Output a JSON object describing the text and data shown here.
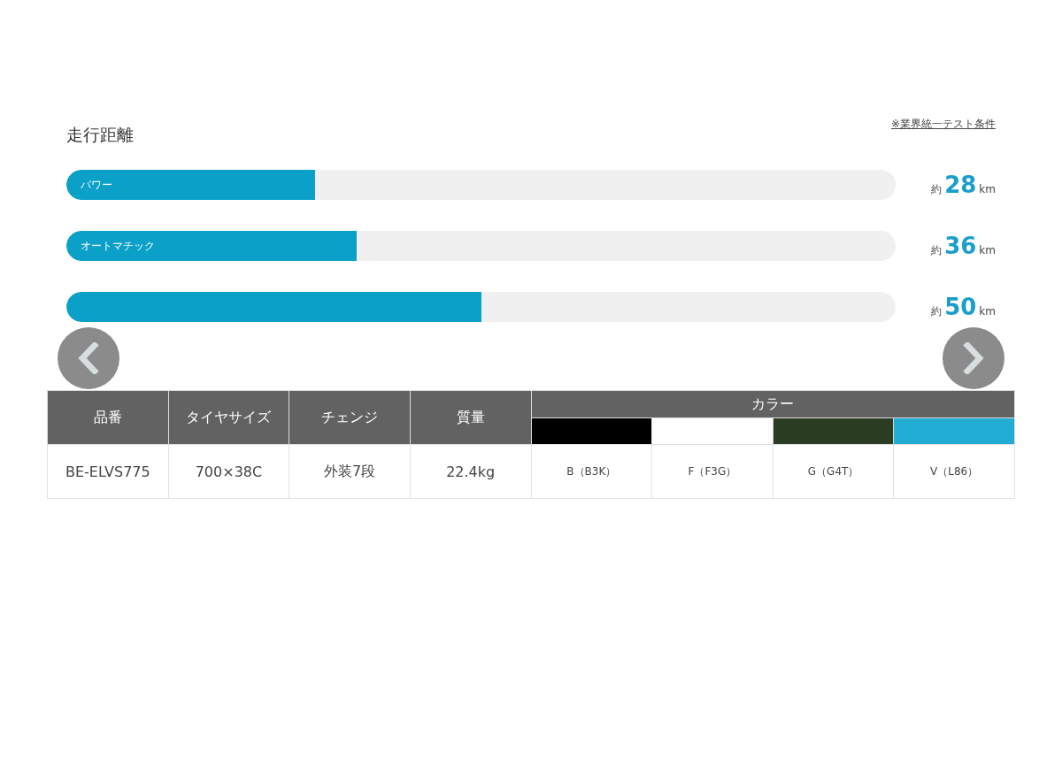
{
  "range": {
    "title": "走行距離",
    "note_link": "※業界統一テスト条件",
    "modes": [
      {
        "label": "パワー",
        "level": 0.3,
        "prefix": "約",
        "value": "28",
        "unit": "km"
      },
      {
        "label": "オートマチック",
        "level": 0.35,
        "prefix": "約",
        "value": "36",
        "unit": "km"
      },
      {
        "level": 0.5,
        "prefix": "約",
        "value": "50",
        "unit": "km"
      }
    ]
  },
  "spec_table": {
    "columns": [
      "品番",
      "タイヤサイズ",
      "チェンジ",
      "質量"
    ],
    "color_heading": "カラー",
    "row": [
      "BE-ELVS775",
      "700×38C",
      "外装7段",
      "22.4kg"
    ],
    "colors": [
      {
        "color": "#000000",
        "label": "B（B3K）"
      },
      {
        "color": "#ffffff",
        "label": "F（F3G）"
      },
      {
        "color": "#2a3d22",
        "label": "G（G4T）"
      },
      {
        "color": "#22aed4",
        "label": "V（L86）"
      }
    ]
  }
}
